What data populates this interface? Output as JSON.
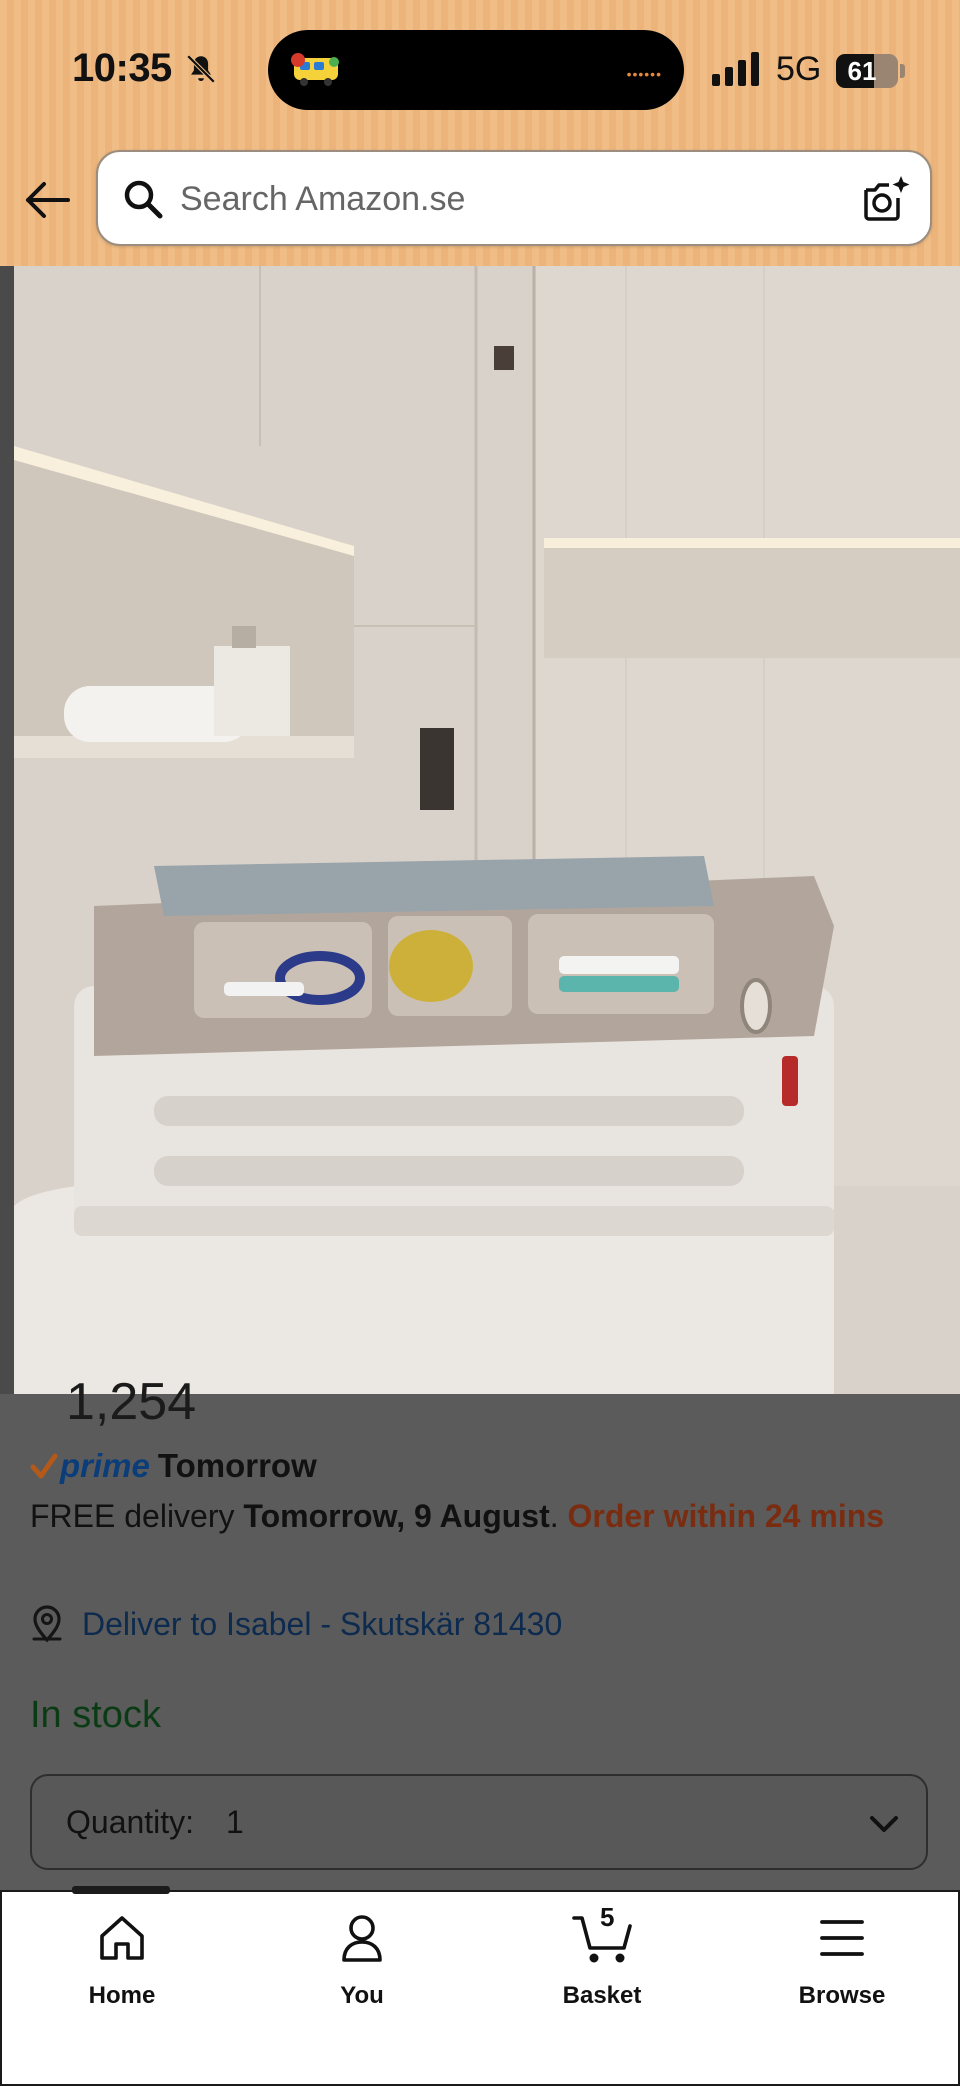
{
  "status_bar": {
    "time": "10:35",
    "network": "5G",
    "battery": "61"
  },
  "search": {
    "placeholder": "Search Amazon.se"
  },
  "product": {
    "price_partial": "1,254",
    "prime_label": "prime",
    "prime_delivery": "Tomorrow",
    "delivery_prefix": "FREE delivery ",
    "delivery_date": "Tomorrow, 9 August",
    "delivery_sep": ". ",
    "order_within": "Order within 24 mins",
    "deliver_to": "Deliver to Isabel - Skutskär 81430",
    "stock_status": "In stock",
    "quantity_label": "Quantity:",
    "quantity_value": "1"
  },
  "tabbar": {
    "tabs": [
      {
        "label": "Home",
        "icon": "home-icon"
      },
      {
        "label": "You",
        "icon": "person-icon"
      },
      {
        "label": "Basket",
        "icon": "cart-icon"
      },
      {
        "label": "Browse",
        "icon": "menu-icon"
      }
    ],
    "basket_count": "5"
  },
  "colors": {
    "header_bg": "#f0bd86",
    "prime_blue": "#0a3d7a",
    "in_stock_green": "#0b3b14",
    "urgent_red": "#7a2c10",
    "link_blue": "#0d2a4f"
  }
}
